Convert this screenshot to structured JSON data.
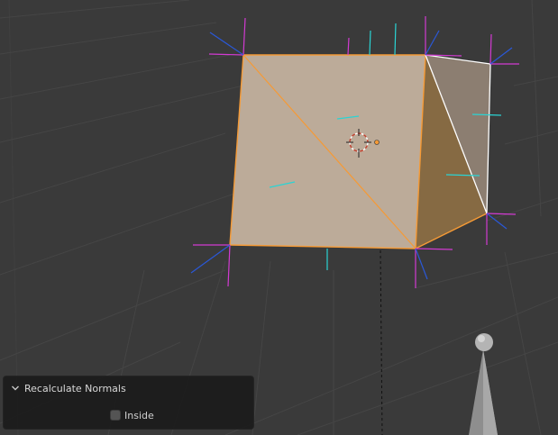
{
  "operator_panel": {
    "title": "Recalculate Normals",
    "options": [
      {
        "label": "Inside",
        "checked": false
      }
    ]
  },
  "colors": {
    "background": "#3a3a3a",
    "grid": "#444444",
    "face_front": "#bcab99",
    "face_side_dark": "#866a43",
    "face_side_light": "#8c7e71",
    "selection_edge": "#f59a36",
    "active_edge": "#ffffff",
    "vertex_normal": "#d23ad2",
    "split_normal": "#2a58d8",
    "face_normal": "#2ad4d4",
    "panel_bg": "#1c1c1c",
    "light_object": "#9a9a9a"
  },
  "icons": {
    "collapse": "chevron-down-icon",
    "origin": "3d-cursor-icon",
    "light": "light-object-icon"
  }
}
